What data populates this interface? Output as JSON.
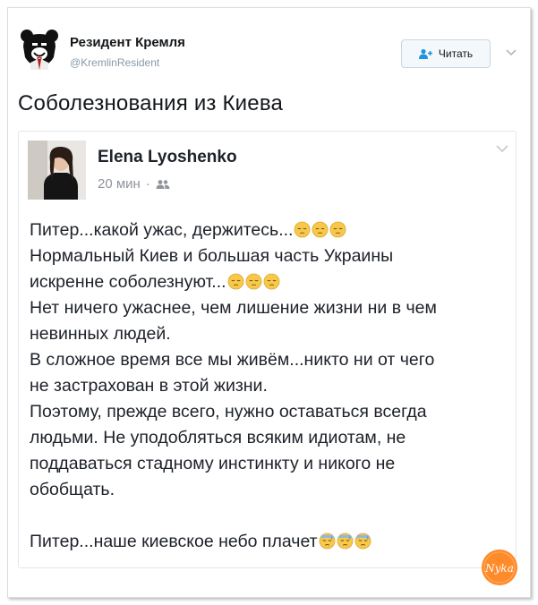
{
  "tweet": {
    "author_name": "Резидент Кремля",
    "author_handle": "@KremlinResident",
    "follow_label": "Читать",
    "text": "Соболезнования из Киева"
  },
  "fb_post": {
    "author": "Elena Lyoshenko",
    "time": "20 мин",
    "separator": "·",
    "lines": [
      "Питер...какой ужас, держитесь...",
      "Нормальный Киев и большая часть Украины",
      "искренне соболезнуют...",
      "Нет ничего ужаснее, чем лишение жизни ни в чем",
      "невинных людей.",
      "В сложное время все мы живём...никто ни от чего",
      "не застрахован в этой жизни.",
      "Поэтому, прежде всего, нужно оставаться всегда",
      "людьми. Не уподобляться всяким идиотам, не",
      "поддаваться стадному инстинкту и никого не",
      "обобщать.",
      "Питер...наше киевское небо плачет"
    ],
    "icons": {
      "pensive_emoji": "pensive-face",
      "sad_sweat_emoji": "downcast-face-with-sweat",
      "audience": "friends-icon"
    }
  },
  "watermark": {
    "text": "Nyka"
  },
  "colors": {
    "twitter_blue": "#1b95e0",
    "emoji_yellow": "#f7c84a",
    "fb_text": "#1d2129"
  }
}
